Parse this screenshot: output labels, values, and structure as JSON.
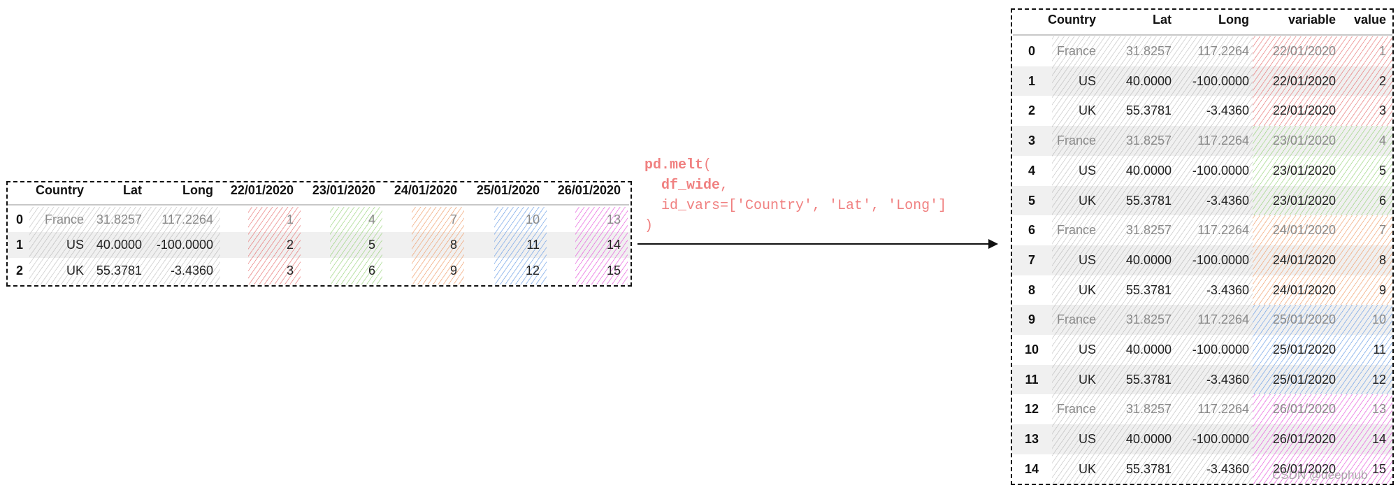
{
  "wide_table": {
    "headers": [
      "Country",
      "Lat",
      "Long",
      "22/01/2020",
      "23/01/2020",
      "24/01/2020",
      "25/01/2020",
      "26/01/2020"
    ],
    "rows": [
      {
        "index": "0",
        "cells": [
          "France",
          "31.8257",
          "117.2264",
          "1",
          "4",
          "7",
          "10",
          "13"
        ]
      },
      {
        "index": "1",
        "cells": [
          "US",
          "40.0000",
          "-100.0000",
          "2",
          "5",
          "8",
          "11",
          "14"
        ]
      },
      {
        "index": "2",
        "cells": [
          "UK",
          "55.3781",
          "-3.4360",
          "3",
          "6",
          "9",
          "12",
          "15"
        ]
      }
    ]
  },
  "code": {
    "line1_func": "pd.melt",
    "line1_paren": "(",
    "line2_arg": "df_wide",
    "line2_comma": ",",
    "line3": "id_vars=['Country', 'Lat', 'Long']",
    "line4": ")"
  },
  "long_table": {
    "headers": [
      "Country",
      "Lat",
      "Long",
      "variable",
      "value"
    ],
    "rows": [
      {
        "index": "0",
        "cells": [
          "France",
          "31.8257",
          "117.2264",
          "22/01/2020",
          "1"
        ]
      },
      {
        "index": "1",
        "cells": [
          "US",
          "40.0000",
          "-100.0000",
          "22/01/2020",
          "2"
        ]
      },
      {
        "index": "2",
        "cells": [
          "UK",
          "55.3781",
          "-3.4360",
          "22/01/2020",
          "3"
        ]
      },
      {
        "index": "3",
        "cells": [
          "France",
          "31.8257",
          "117.2264",
          "23/01/2020",
          "4"
        ]
      },
      {
        "index": "4",
        "cells": [
          "US",
          "40.0000",
          "-100.0000",
          "23/01/2020",
          "5"
        ]
      },
      {
        "index": "5",
        "cells": [
          "UK",
          "55.3781",
          "-3.4360",
          "23/01/2020",
          "6"
        ]
      },
      {
        "index": "6",
        "cells": [
          "France",
          "31.8257",
          "117.2264",
          "24/01/2020",
          "7"
        ]
      },
      {
        "index": "7",
        "cells": [
          "US",
          "40.0000",
          "-100.0000",
          "24/01/2020",
          "8"
        ]
      },
      {
        "index": "8",
        "cells": [
          "UK",
          "55.3781",
          "-3.4360",
          "24/01/2020",
          "9"
        ]
      },
      {
        "index": "9",
        "cells": [
          "France",
          "31.8257",
          "117.2264",
          "25/01/2020",
          "10"
        ]
      },
      {
        "index": "10",
        "cells": [
          "US",
          "40.0000",
          "-100.0000",
          "25/01/2020",
          "11"
        ]
      },
      {
        "index": "11",
        "cells": [
          "UK",
          "55.3781",
          "-3.4360",
          "25/01/2020",
          "12"
        ]
      },
      {
        "index": "12",
        "cells": [
          "France",
          "31.8257",
          "117.2264",
          "26/01/2020",
          "13"
        ]
      },
      {
        "index": "13",
        "cells": [
          "US",
          "40.0000",
          "-100.0000",
          "26/01/2020",
          "14"
        ]
      },
      {
        "index": "14",
        "cells": [
          "UK",
          "55.3781",
          "-3.4360",
          "26/01/2020",
          "15"
        ]
      }
    ]
  },
  "colors": {
    "code_text": "#f08080",
    "date_groups": [
      "red",
      "green",
      "orange",
      "blue",
      "magenta"
    ]
  },
  "watermark": "CSDN @deephub"
}
